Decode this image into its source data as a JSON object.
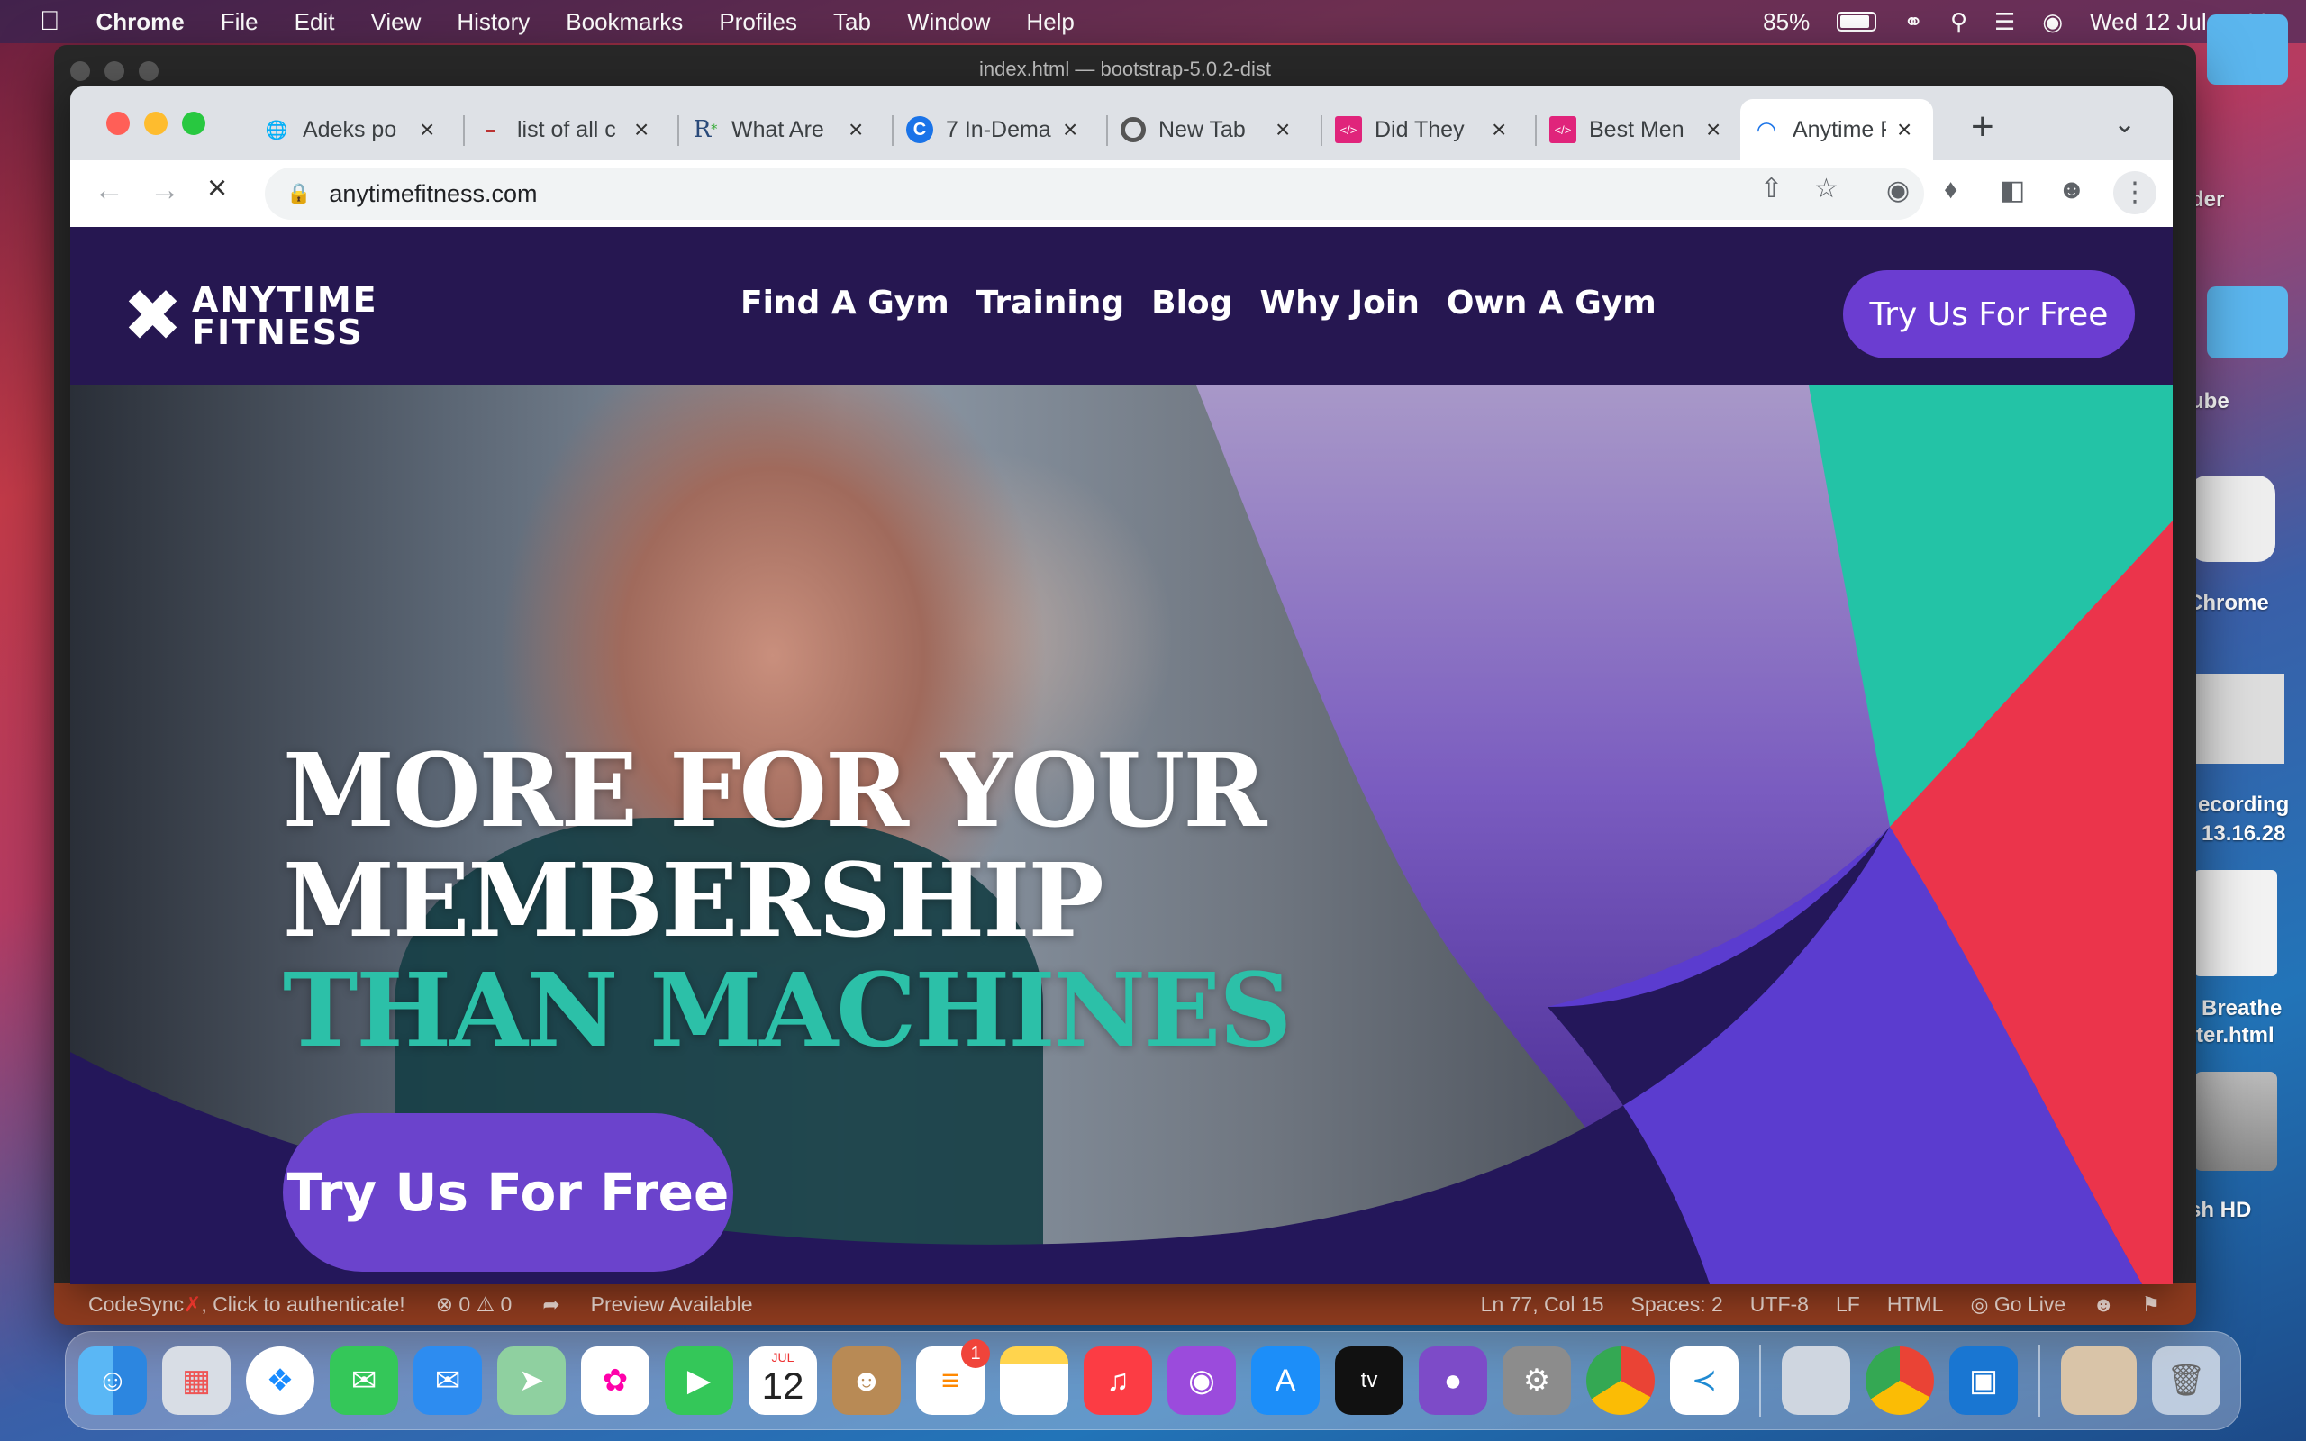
{
  "menubar": {
    "app": "Chrome",
    "items": [
      "File",
      "Edit",
      "View",
      "History",
      "Bookmarks",
      "Profiles",
      "Tab",
      "Window",
      "Help"
    ],
    "battery": "85%",
    "datetime": "Wed 12 Jul  11:33"
  },
  "vscode": {
    "title": "index.html — bootstrap-5.0.2-dist",
    "status": {
      "codesync": "CodeSync",
      "auth": ", Click to authenticate!",
      "problems": "⊗ 0 ⚠ 0",
      "preview": "Preview Available",
      "position": "Ln 77, Col 15",
      "spaces": "Spaces: 2",
      "encoding": "UTF-8",
      "eol": "LF",
      "language": "HTML",
      "golive": "Go Live"
    }
  },
  "desktop": {
    "labels": [
      "der",
      "ube",
      "Chrome",
      "ecording",
      "13.16.28",
      "Breathe",
      "tter.html",
      "sh HD"
    ]
  },
  "tabs": [
    {
      "title": "Adeks po",
      "icon": "globe-icon"
    },
    {
      "title": "list of all c",
      "icon": "site-icon"
    },
    {
      "title": "What Are",
      "icon": "r-icon"
    },
    {
      "title": "7 In-Dema",
      "icon": "c-icon"
    },
    {
      "title": "New Tab",
      "icon": "chrome-icon"
    },
    {
      "title": "Did They",
      "icon": "code-icon"
    },
    {
      "title": "Best Men",
      "icon": "code-icon"
    },
    {
      "title": "Anytime F",
      "icon": "loading-icon"
    }
  ],
  "address": {
    "url": "anytimefitness.com"
  },
  "site": {
    "logo_line1": "ANYTIME",
    "logo_line2": "FITNESS",
    "nav": [
      "Find A Gym",
      "Training",
      "Blog",
      "Why Join",
      "Own A Gym"
    ],
    "nav_cta": "Try Us For Free",
    "headline_line1": "MORE FOR YOUR",
    "headline_line2": "MEMBERSHIP",
    "headline_line3": "THAN MACHINES",
    "hero_cta": "Try Us For Free"
  },
  "dock": {
    "calendar_month": "JUL",
    "calendar_day": "12",
    "reminders_badge": "1"
  }
}
